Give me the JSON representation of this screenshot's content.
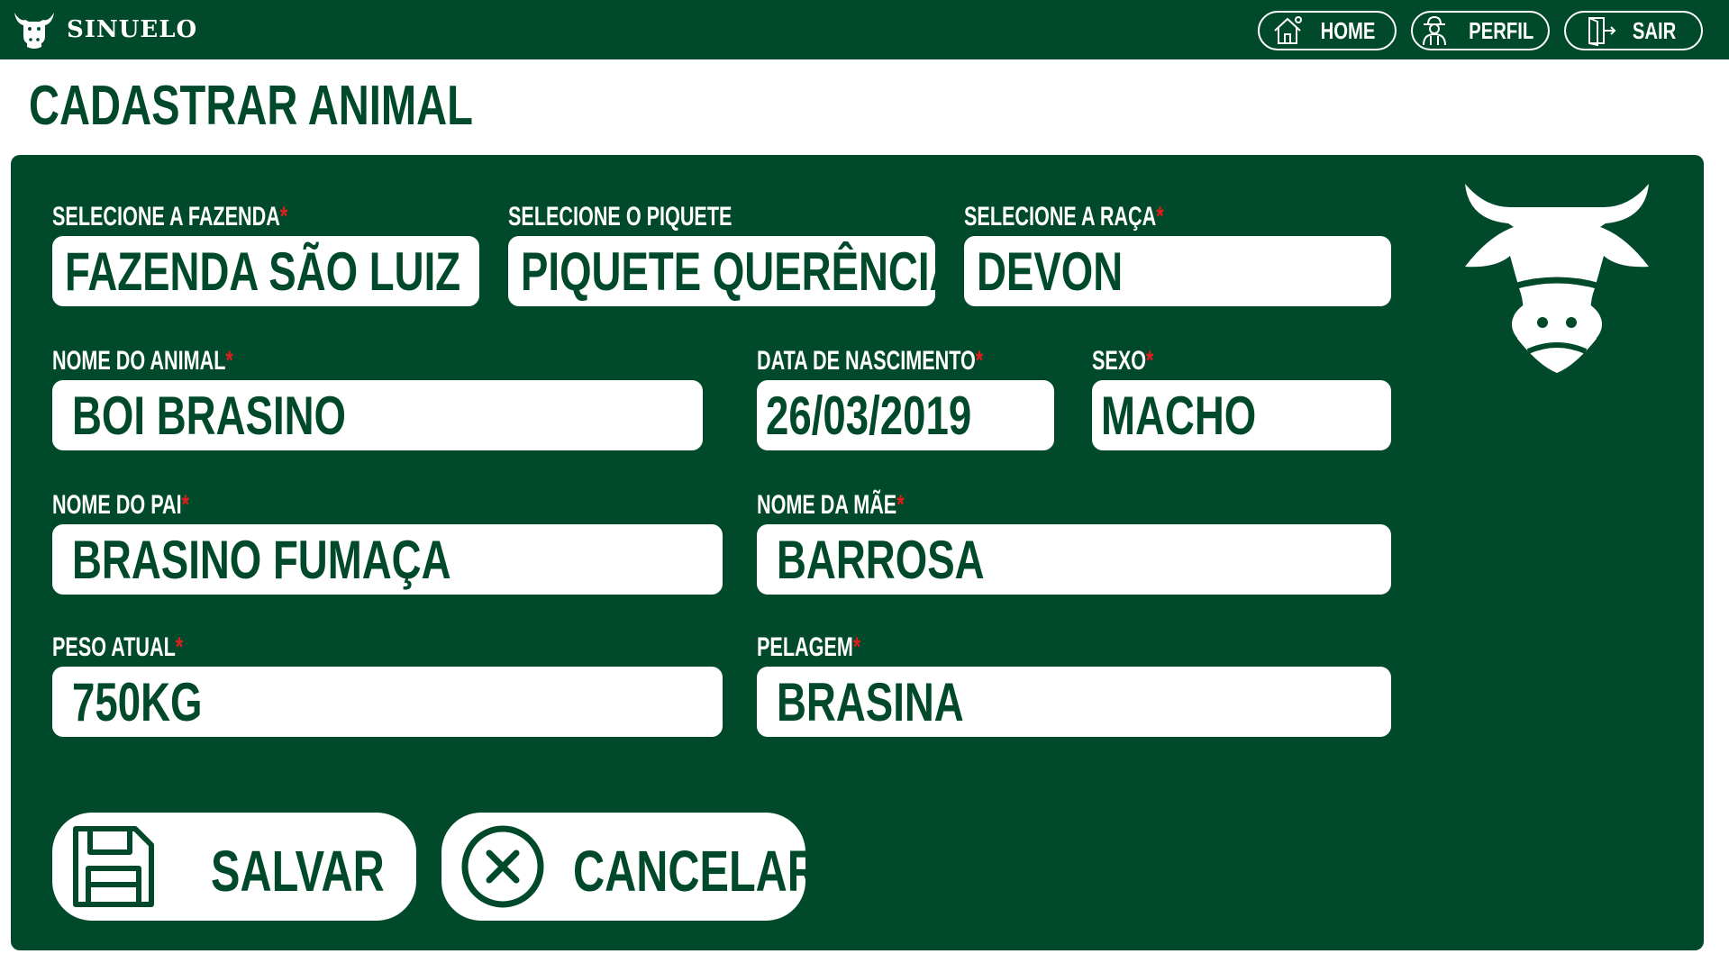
{
  "app": {
    "name": "SINUELO"
  },
  "nav": {
    "home_label": "HOME",
    "perfil_label": "PERFIL",
    "sair_label": "SAIR"
  },
  "page": {
    "title": "CADASTRAR ANIMAL"
  },
  "form": {
    "fazenda": {
      "label": "SELECIONE A FAZENDA",
      "required": "*",
      "value": "FAZENDA SÃO LUIZ"
    },
    "piquete": {
      "label": "SELECIONE O PIQUETE",
      "value": "PIQUETE QUERÊNCIA"
    },
    "raca": {
      "label": "SELECIONE A RAÇA",
      "required": "*",
      "value": "DEVON"
    },
    "nome_animal": {
      "label": "NOME DO ANIMAL",
      "required": "*",
      "value": "BOI BRASINO"
    },
    "data_nascimento": {
      "label": "DATA DE NASCIMENTO",
      "required": "*",
      "value": "26/03/2019"
    },
    "sexo": {
      "label": "SEXO",
      "required": "*",
      "value": "MACHO"
    },
    "nome_pai": {
      "label": "NOME DO PAI",
      "required": "*",
      "value": "BRASINO FUMAÇA"
    },
    "nome_mae": {
      "label": "NOME DA MÃE",
      "required": "*",
      "value": "BARROSA"
    },
    "peso_atual": {
      "label": "PESO ATUAL",
      "required": "*",
      "value": "750KG"
    },
    "pelagem": {
      "label": "PELAGEM",
      "required": "*",
      "value": "BRASINA"
    }
  },
  "actions": {
    "save_label": "SALVAR",
    "cancel_label": "CANCELAR"
  },
  "colors": {
    "primary": "#00492a",
    "background": "#ffffff",
    "required": "#e01e1e"
  },
  "icons": {
    "logo": "cow-head-icon",
    "home": "house-icon",
    "perfil": "farmer-icon",
    "sair": "exit-door-icon",
    "salvar": "floppy-disk-icon",
    "cancelar": "close-circle-icon",
    "decor": "cow-head-icon"
  }
}
